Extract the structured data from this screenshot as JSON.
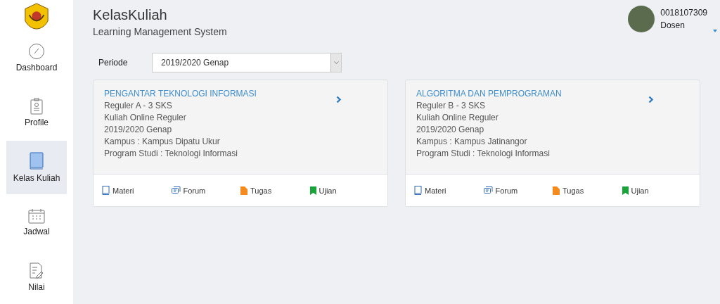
{
  "app": {
    "title": "KelasKuliah",
    "subtitle": "Learning Management System"
  },
  "sidebar": {
    "items": [
      {
        "label": "Dashboard",
        "kind": "dashboard",
        "selected": false
      },
      {
        "label": "Profile",
        "kind": "profile",
        "selected": false
      },
      {
        "label": "Kelas Kuliah",
        "kind": "book",
        "selected": true
      },
      {
        "label": "Jadwal",
        "kind": "calendar",
        "selected": false
      },
      {
        "label": "Nilai",
        "kind": "grades",
        "selected": false
      }
    ]
  },
  "user": {
    "id": "0018107309",
    "role": "Dosen"
  },
  "filter": {
    "label": "Periode",
    "value": "2019/2020 Genap"
  },
  "courses": [
    {
      "title": "PENGANTAR TEKNOLOGI INFORMASI",
      "details": [
        "Reguler A - 3 SKS",
        "Kuliah Online Reguler",
        "2019/2020 Genap",
        "Kampus : Kampus Dipatu Ukur",
        "Program Studi : Teknologi Informasi"
      ],
      "actions": [
        {
          "label": "Materi",
          "kind": "materi"
        },
        {
          "label": "Forum",
          "kind": "forum"
        },
        {
          "label": "Tugas",
          "kind": "tugas"
        },
        {
          "label": "Ujian",
          "kind": "ujian"
        }
      ]
    },
    {
      "title": "ALGORITMA DAN PEMPROGRAMAN",
      "details": [
        "Reguler B - 3 SKS",
        "Kuliah Online Reguler",
        "2019/2020 Genap",
        "Kampus : Kampus Jatinangor",
        "Program Studi : Teknologi Informasi"
      ],
      "actions": [
        {
          "label": "Materi",
          "kind": "materi"
        },
        {
          "label": "Forum",
          "kind": "forum"
        },
        {
          "label": "Tugas",
          "kind": "tugas"
        },
        {
          "label": "Ujian",
          "kind": "ujian"
        }
      ]
    }
  ]
}
